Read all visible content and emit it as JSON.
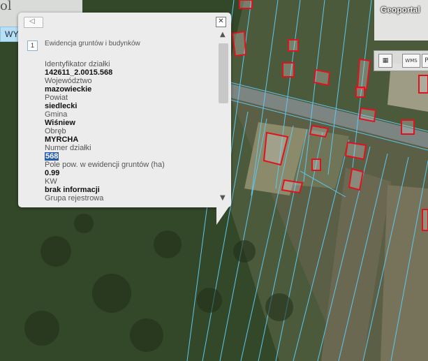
{
  "header": {
    "fragment_text": "ol",
    "search_tab_label": "WYSZUKIWANIA",
    "brand": "Geoportal"
  },
  "toolbar": {
    "tools": [
      {
        "icon": "grid-icon",
        "glyph": "▦"
      },
      {
        "icon": "wms-icon",
        "glyph": "WMS"
      },
      {
        "icon": "print-icon",
        "glyph": "P"
      }
    ]
  },
  "popup": {
    "item_number": "1",
    "item_title": "Ewidencja gruntów i budynków",
    "close_glyph": "✕",
    "collapse_glyph": "◁",
    "fields": [
      {
        "label": "Identyfikator działki",
        "value": "142611_2.0015.568"
      },
      {
        "label": "Województwo",
        "value": "mazowieckie"
      },
      {
        "label": "Powiat",
        "value": "siedlecki"
      },
      {
        "label": "Gmina",
        "value": "Wiśniew"
      },
      {
        "label": "Obręb",
        "value": "MYRCHA"
      },
      {
        "label": "Numer działki",
        "value": "568",
        "highlighted": true
      },
      {
        "label": "Pole pow. w ewidencji gruntów (ha)",
        "value": "0.99"
      },
      {
        "label": "KW",
        "value": "brak informacji"
      },
      {
        "label": "Grupa rejestrowa",
        "value": ""
      }
    ],
    "scroll_up_glyph": "▲",
    "scroll_down_glyph": "▼"
  },
  "colors": {
    "parcel_line": "#5ec8f2",
    "building_outline": "#e0121e",
    "forest": "#2f4126",
    "road": "#7d8583"
  }
}
